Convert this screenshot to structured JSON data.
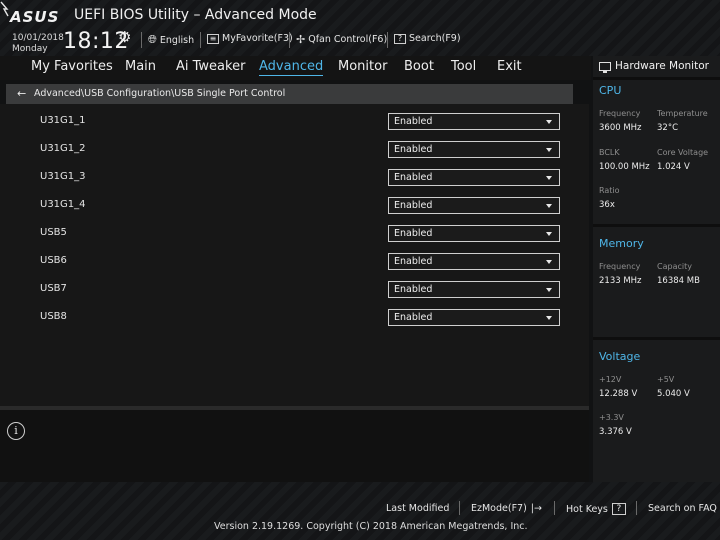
{
  "header": {
    "logo": "ASUS",
    "title": "UEFI BIOS Utility – Advanced Mode",
    "date": "10/01/2018",
    "day": "Monday",
    "time": "18:12",
    "language": "English",
    "my_favorite": "MyFavorite(F3)",
    "qfan": "Qfan Control(F6)",
    "search": "Search(F9)"
  },
  "menu": {
    "items": [
      "My Favorites",
      "Main",
      "Ai Tweaker",
      "Advanced",
      "Monitor",
      "Boot",
      "Tool",
      "Exit"
    ],
    "active": "Advanced"
  },
  "breadcrumb": "Advanced\\USB Configuration\\USB Single Port Control",
  "settings": [
    {
      "label": "U31G1_1",
      "value": "Enabled"
    },
    {
      "label": "U31G1_2",
      "value": "Enabled"
    },
    {
      "label": "U31G1_3",
      "value": "Enabled"
    },
    {
      "label": "U31G1_4",
      "value": "Enabled"
    },
    {
      "label": "USB5",
      "value": "Enabled"
    },
    {
      "label": "USB6",
      "value": "Enabled"
    },
    {
      "label": "USB7",
      "value": "Enabled"
    },
    {
      "label": "USB8",
      "value": "Enabled"
    }
  ],
  "hardware_monitor": {
    "title": "Hardware Monitor",
    "cpu": {
      "heading": "CPU",
      "frequency_label": "Frequency",
      "frequency": "3600 MHz",
      "temperature_label": "Temperature",
      "temperature": "32°C",
      "bclk_label": "BCLK",
      "bclk": "100.00 MHz",
      "core_voltage_label": "Core Voltage",
      "core_voltage": "1.024 V",
      "ratio_label": "Ratio",
      "ratio": "36x"
    },
    "memory": {
      "heading": "Memory",
      "frequency_label": "Frequency",
      "frequency": "2133 MHz",
      "capacity_label": "Capacity",
      "capacity": "16384 MB"
    },
    "voltage": {
      "heading": "Voltage",
      "v12_label": "+12V",
      "v12": "12.288 V",
      "v5_label": "+5V",
      "v5": "5.040 V",
      "v33_label": "+3.3V",
      "v33": "3.376 V"
    }
  },
  "footer": {
    "last_modified": "Last Modified",
    "ezmode": "EzMode(F7)",
    "hot_keys": "Hot Keys",
    "search_faq": "Search on FAQ",
    "copyright": "Version 2.19.1269. Copyright (C) 2018 American Megatrends, Inc."
  },
  "colors": {
    "accent": "#4fb6e8",
    "background": "#171717"
  }
}
